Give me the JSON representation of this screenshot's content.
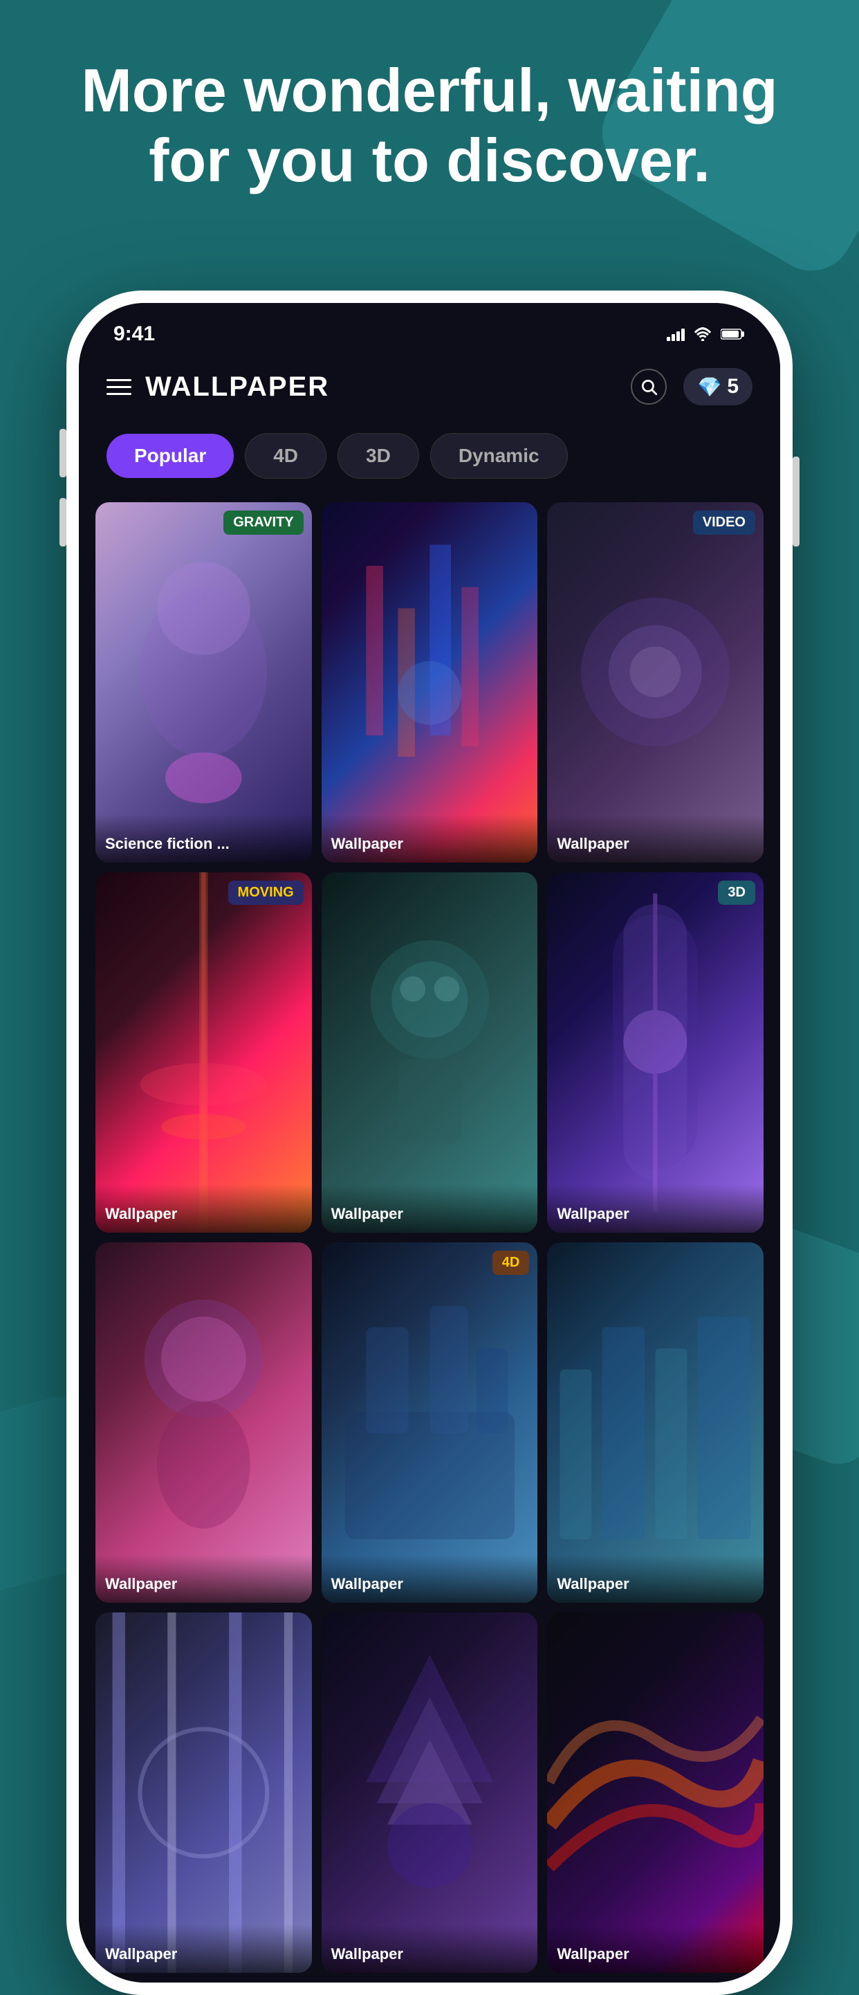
{
  "hero": {
    "title": "More wonderful, waiting for you to discover."
  },
  "status_bar": {
    "time": "9:41",
    "signal": "signal",
    "wifi": "wifi",
    "battery": "battery"
  },
  "header": {
    "title": "WALLPAPER",
    "search_label": "search",
    "gems_count": "5"
  },
  "tabs": [
    {
      "label": "Popular",
      "active": true
    },
    {
      "label": "4D",
      "active": false
    },
    {
      "label": "3D",
      "active": false
    },
    {
      "label": "Dynamic",
      "active": false
    }
  ],
  "grid": {
    "items": [
      {
        "label": "Science fiction ...",
        "badge": "GRAVITY",
        "badge_type": "gravity",
        "bg": "wp-1"
      },
      {
        "label": "Wallpaper",
        "badge": null,
        "bg": "wp-2"
      },
      {
        "label": "Wallpaper",
        "badge": "VIDEO",
        "badge_type": "video",
        "bg": "wp-3"
      },
      {
        "label": "Wallpaper",
        "badge": "MOVING",
        "badge_type": "moving",
        "bg": "wp-4"
      },
      {
        "label": "Wallpaper",
        "badge": null,
        "bg": "wp-5"
      },
      {
        "label": "Wallpaper",
        "badge": "3D",
        "badge_type": "3d",
        "bg": "wp-6"
      },
      {
        "label": "Wallpaper",
        "badge": null,
        "bg": "wp-7"
      },
      {
        "label": "Wallpaper",
        "badge": "4D",
        "badge_type": "4d",
        "bg": "wp-8"
      },
      {
        "label": "Wallpaper",
        "badge": null,
        "bg": "wp-9"
      },
      {
        "label": "Wallpaper",
        "badge": null,
        "bg": "wp-10"
      },
      {
        "label": "Wallpaper",
        "badge": null,
        "bg": "wp-11"
      },
      {
        "label": "Wallpaper",
        "badge": null,
        "bg": "wp-12"
      }
    ]
  }
}
